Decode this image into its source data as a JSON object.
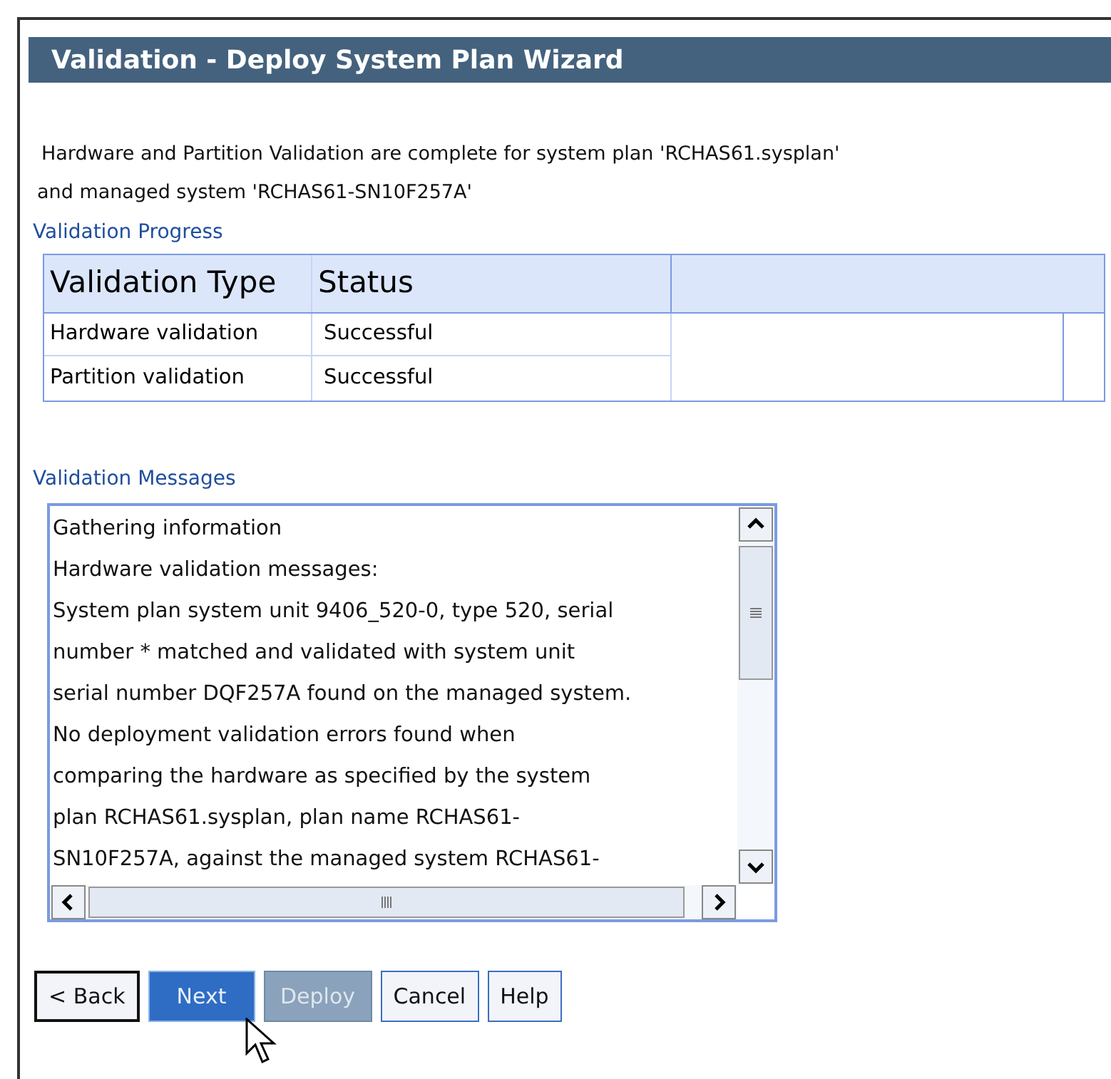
{
  "window": {
    "title": "Validation - Deploy System Plan Wizard"
  },
  "intro": [
    "Hardware and Partition Validation are complete for system plan 'RCHAS61.sysplan'",
    "and managed system 'RCHAS61-SN10F257A'"
  ],
  "progress": {
    "heading": "Validation Progress",
    "columns": [
      "Validation Type",
      "Status"
    ],
    "rows": [
      {
        "type": "Hardware validation",
        "status": "Successful"
      },
      {
        "type": "Partition validation",
        "status": "Successful"
      }
    ]
  },
  "messages": {
    "heading": "Validation Messages",
    "lines": [
      "Gathering information",
      "Hardware validation messages:",
      "System plan system unit 9406_520-0, type 520, serial",
      "number * matched and validated with system unit",
      "serial number DQF257A found on the managed system.",
      "No deployment validation errors found when",
      "comparing the hardware as specified by the system",
      "plan RCHAS61.sysplan, plan name RCHAS61-",
      "SN10F257A, against the managed system RCHAS61-"
    ]
  },
  "buttons": [
    {
      "label": "< Back",
      "kind": "normal",
      "focused": true,
      "disabled": false
    },
    {
      "label": "Next",
      "kind": "primary",
      "focused": false,
      "disabled": false
    },
    {
      "label": "Deploy",
      "kind": "primary",
      "focused": false,
      "disabled": true
    },
    {
      "label": "Cancel",
      "kind": "normal",
      "focused": false,
      "disabled": false
    },
    {
      "label": "Help",
      "kind": "normal",
      "focused": false,
      "disabled": false
    }
  ]
}
